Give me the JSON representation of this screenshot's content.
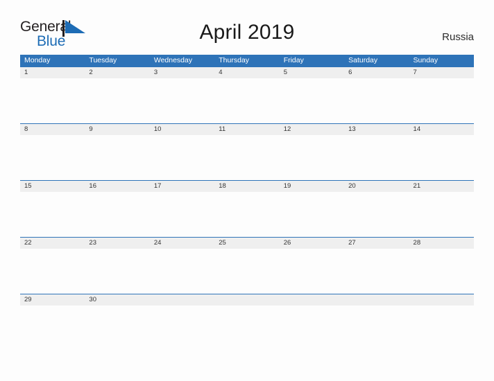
{
  "brand": {
    "line1": "General",
    "line2": "Blue",
    "flag_icon": "flag-triangle-icon",
    "color_text": "#231f20",
    "color_blue": "#1d6cb5"
  },
  "header": {
    "title": "April 2019",
    "country": "Russia"
  },
  "theme": {
    "header_bar": "#2e73b8",
    "band": "#efefef",
    "rule": "#2e73b8",
    "page_bg": "#fdfdfd"
  },
  "calendar": {
    "weekdays": [
      "Monday",
      "Tuesday",
      "Wednesday",
      "Thursday",
      "Friday",
      "Saturday",
      "Sunday"
    ],
    "weeks": [
      [
        "1",
        "2",
        "3",
        "4",
        "5",
        "6",
        "7"
      ],
      [
        "8",
        "9",
        "10",
        "11",
        "12",
        "13",
        "14"
      ],
      [
        "15",
        "16",
        "17",
        "18",
        "19",
        "20",
        "21"
      ],
      [
        "22",
        "23",
        "24",
        "25",
        "26",
        "27",
        "28"
      ],
      [
        "29",
        "30",
        "",
        "",
        "",
        "",
        ""
      ]
    ]
  }
}
